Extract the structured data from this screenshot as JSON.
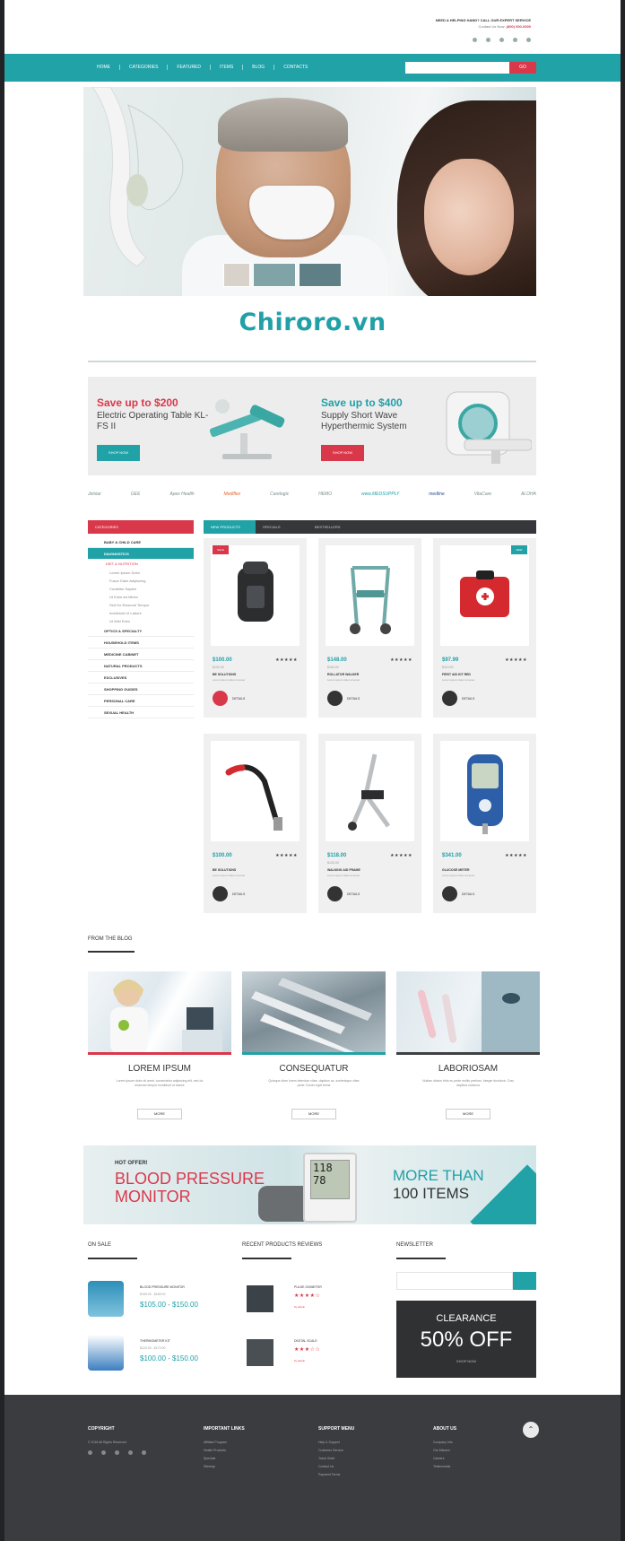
{
  "header": {
    "note": "NEED A HELPING HAND? CALL OUR EXPERT SERVICE",
    "sub_label": "Contact Us Now:",
    "phone": "(800) 000-0000",
    "social": [
      "facebook-icon",
      "twitter-icon",
      "google-plus-icon",
      "pinterest-icon",
      "youtube-icon"
    ]
  },
  "nav": {
    "items": [
      "HOME",
      "CATEGORIES",
      "FEATURED",
      "ITEMS",
      "BLOG",
      "CONTACTS"
    ],
    "search_placeholder": "",
    "search_button": "GO"
  },
  "brand": {
    "name": "Chiroro.vn"
  },
  "promos": [
    {
      "title": "Save up to $200",
      "subtitle": "Electric Operating Table KL-FS II",
      "button": "SHOP NOW"
    },
    {
      "title": "Save up to $400",
      "subtitle": "Supply Short Wave Hyperthermic System",
      "button": "SHOP NOW"
    }
  ],
  "brands": [
    "Jetstar",
    "GEE",
    "Apex Health",
    "Mediflex",
    "Carelogic",
    "HEMO",
    "www.MEDSUPPLY",
    "medline",
    "VitaCare",
    "ALOHA"
  ],
  "sidebar": {
    "heading": "CATEGORIES",
    "items": [
      {
        "label": "BABY & CHILD CARE",
        "type": "item"
      },
      {
        "label": "DIAGNOSTICS",
        "type": "active"
      },
      {
        "label": "DIET & NUTRITION",
        "type": "sub"
      },
      {
        "label": "Lorem Ipsum Dolor",
        "type": "subsub"
      },
      {
        "label": "Fusce Diam Adipiscing",
        "type": "subsub"
      },
      {
        "label": "Curabitur Sapien",
        "type": "subsub"
      },
      {
        "label": "Ut Enim Ad Minim",
        "type": "subsub"
      },
      {
        "label": "Sed Do Eiusmod Tempor",
        "type": "subsub"
      },
      {
        "label": "Incididunt Ut Labore",
        "type": "subsub"
      },
      {
        "label": "Ut Wisi Enim",
        "type": "subsub"
      },
      {
        "label": "OPTICS & SPECIALTY",
        "type": "item"
      },
      {
        "label": "HOUSEHOLD ITEMS",
        "type": "item"
      },
      {
        "label": "MEDICINE CABINET",
        "type": "item"
      },
      {
        "label": "NATURAL PRODUCTS",
        "type": "item"
      },
      {
        "label": "EXCLUSIVES",
        "type": "item"
      },
      {
        "label": "SHOPPING GUIDES",
        "type": "item"
      },
      {
        "label": "PERSONAL CARE",
        "type": "item"
      },
      {
        "label": "SEXUAL HEALTH",
        "type": "item"
      }
    ]
  },
  "product_tabs": [
    "NEW PRODUCTS",
    "SPECIALS",
    "BESTSELLERS"
  ],
  "products": [
    {
      "price": "$100.00",
      "old": "$130.00",
      "name": "BE SOLUTIONS",
      "desc": "Lorem ipsum dolor sit amet",
      "stars": "★★★★★",
      "tag": "SALE",
      "tag_color": "#d9384a",
      "cart": "DETAILS"
    },
    {
      "price": "$148.00",
      "old": "$160.00",
      "name": "ROLLATOR WALKER",
      "desc": "Lorem ipsum dolor sit amet",
      "stars": "★★★★★",
      "tag": "",
      "tag_color": "",
      "cart": "DETAILS"
    },
    {
      "price": "$97.99",
      "old": "$110.00",
      "name": "FIRST AID KIT RED",
      "desc": "Lorem ipsum dolor sit amet",
      "stars": "★★★★★",
      "tag": "NEW",
      "tag_color": "#20a2a7",
      "cart": "DETAILS"
    },
    {
      "price": "$100.00",
      "old": "",
      "name": "BE SOLUTIONS",
      "desc": "Lorem ipsum dolor sit amet",
      "stars": "★★★★★",
      "tag": "",
      "tag_color": "",
      "cart": "DETAILS"
    },
    {
      "price": "$118.00",
      "old": "$130.00",
      "name": "WALKING AID FRAME",
      "desc": "Lorem ipsum dolor sit amet",
      "stars": "★★★★★",
      "tag": "",
      "tag_color": "",
      "cart": "DETAILS"
    },
    {
      "price": "$341.00",
      "old": "",
      "name": "GLUCOSE METER",
      "desc": "Lorem ipsum dolor sit amet",
      "stars": "★★★★★",
      "tag": "",
      "tag_color": "",
      "cart": "DETAILS"
    }
  ],
  "blog": {
    "heading": "FROM THE BLOG",
    "posts": [
      {
        "title": "LOREM IPSUM",
        "desc": "Lorem ipsum dolor sit amet, consectetur adipiscing elit, sed do eiusmod tempor incididunt ut labore",
        "button": "MORE"
      },
      {
        "title": "CONSEQUATUR",
        "desc": "Quisque diam lorem interdum vitae, dapibus ac, scelerisque vitae pede. Donec eget tellus",
        "button": "MORE"
      },
      {
        "title": "LABORIOSAM",
        "desc": "Nullam dictum felis eu pede mollis pretium. Integer tincidunt. Cras dapibus vivamus",
        "button": "MORE"
      }
    ]
  },
  "hot_banner": {
    "kicker": "HOT OFFER!",
    "title_line1": "BLOOD PRESSURE",
    "title_line2": "MONITOR",
    "more": "MORE THAN",
    "items": "100 ITEMS",
    "display_top": "118",
    "display_bottom": "78"
  },
  "lower": {
    "on_sale_title": "ON SALE",
    "reviews_title": "RECENT PRODUCTS REVIEWS",
    "newsletter_title": "NEWSLETTER",
    "sale_items": [
      {
        "name": "BLOOD PRESSURE MONITOR",
        "old": "$159.00 - $189.00",
        "price": "$105.00 - $150.00"
      },
      {
        "name": "THERMOMETER KIT",
        "old": "$120.00 - $170.00",
        "price": "$100.00 - $150.00"
      }
    ],
    "review_items": [
      {
        "name": "PULSE OXIMETER",
        "stars": "★★★★☆",
        "by": "by admin"
      },
      {
        "name": "DIGITAL SCALE",
        "stars": "★★★☆☆",
        "by": "by admin"
      }
    ],
    "clearance": {
      "line1": "CLEARANCE",
      "line2": "50% OFF",
      "line3": "SHOP NOW"
    }
  },
  "footer": {
    "cols": [
      {
        "heading": "COPYRIGHT",
        "items": [
          "© 2016 All Rights Reserved"
        ]
      },
      {
        "heading": "IMPORTANT LINKS",
        "items": [
          "Affiliate Program",
          "Health Products",
          "Specials",
          "Sitemap"
        ]
      },
      {
        "heading": "SUPPORT MENU",
        "items": [
          "Help & Support",
          "Customer Service",
          "Track Order",
          "Contact Us",
          "Payment Terms"
        ]
      },
      {
        "heading": "ABOUT US",
        "items": [
          "Company Info",
          "Our Mission",
          "Careers",
          "Testimonials"
        ]
      }
    ],
    "social": [
      "facebook-icon",
      "twitter-icon",
      "google-plus-icon",
      "pinterest-icon",
      "youtube-icon"
    ]
  }
}
